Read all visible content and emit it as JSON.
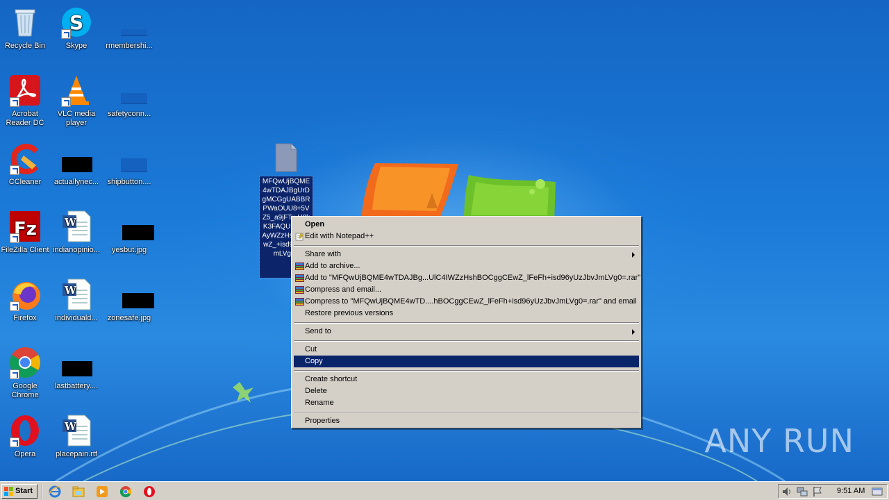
{
  "desktop": {
    "icons": [
      {
        "label": "Recycle Bin"
      },
      {
        "label": "Skype"
      },
      {
        "label": "rmembershi..."
      },
      {
        "label": "Acrobat Reader DC"
      },
      {
        "label": "VLC media player"
      },
      {
        "label": "safetyconn..."
      },
      {
        "label": "CCleaner"
      },
      {
        "label": "actuallynec..."
      },
      {
        "label": "shipbutton...."
      },
      {
        "label": "FileZilla Client"
      },
      {
        "label": "indianopinio..."
      },
      {
        "label": "yesbut.jpg"
      },
      {
        "label": "Firefox"
      },
      {
        "label": "individuald..."
      },
      {
        "label": "zonesafe.jpg"
      },
      {
        "label": "Google Chrome"
      },
      {
        "label": "lastbattery...."
      },
      {
        "label": "Opera"
      },
      {
        "label": "placepain.rtf"
      }
    ],
    "selected_file": {
      "name": "MFQwUjBQME4wTDAJBgUrDgMCGgUABBRPWaOUU8+5VZ5_a9jFTy-H8kK3FAQUhTTsvAyWZzHshgCEwZ_+isd96yUJmLVg0="
    }
  },
  "context_menu": {
    "items": [
      {
        "label": "Open"
      },
      {
        "label": "Edit with Notepad++"
      },
      {
        "label": "Share with"
      },
      {
        "label": "Add to archive..."
      },
      {
        "label": "Add to \"MFQwUjBQME4wTDAJBg...UlC4IWZzHshBOCggCEwZ_lFeFh+isd96yUzJbvJmLVg0=.rar\""
      },
      {
        "label": "Compress and email..."
      },
      {
        "label": "Compress to \"MFQwUjBQME4wTD....hBOCggCEwZ_lFeFh+isd96yUzJbvJmLVg0=.rar\" and email"
      },
      {
        "label": "Restore previous versions"
      },
      {
        "label": "Send to"
      },
      {
        "label": "Cut"
      },
      {
        "label": "Copy"
      },
      {
        "label": "Create shortcut"
      },
      {
        "label": "Delete"
      },
      {
        "label": "Rename"
      },
      {
        "label": "Properties"
      }
    ],
    "highlight_color": "#0a246a"
  },
  "watermark": {
    "text": "ANY RUN"
  },
  "taskbar": {
    "start_label": "Start",
    "quick_launch": [
      "ie-icon",
      "explorer-icon",
      "media-player-icon",
      "chrome-icon",
      "opera-icon"
    ],
    "clock": "9:51 AM"
  }
}
